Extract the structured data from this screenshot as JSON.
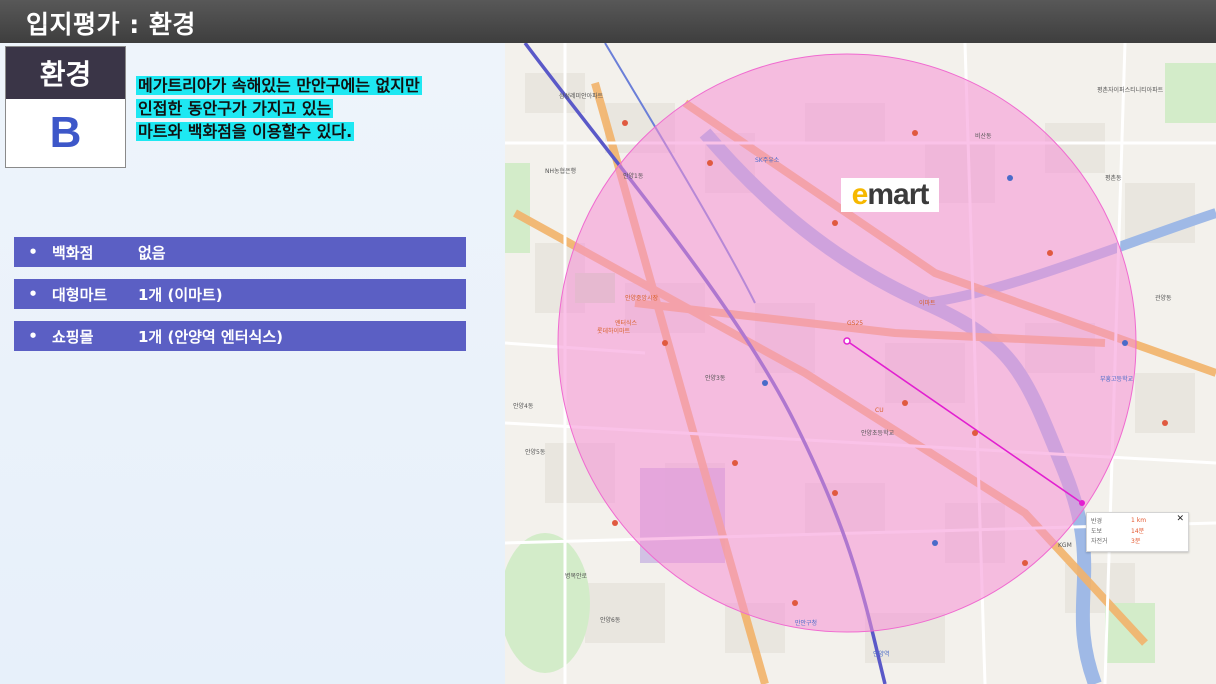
{
  "header": {
    "title": "입지평가 : 환경"
  },
  "grade": {
    "label": "환경",
    "value": "B"
  },
  "note": {
    "lines": [
      "메가트리아가 속해있는 만안구에는 없지만",
      "인접한 동안구가 가지고 있는",
      "마트와 백화점을 이용할수 있다."
    ]
  },
  "facilities": [
    {
      "bullet": "•",
      "name": "백화점",
      "value": "없음"
    },
    {
      "bullet": "•",
      "name": "대형마트",
      "value": "1개 (이마트)"
    },
    {
      "bullet": "•",
      "name": "쇼핑몰",
      "value": "1개 (안양역 엔터식스)"
    }
  ],
  "map": {
    "logo": {
      "prefix": "e",
      "rest": "mart"
    },
    "radius_circle_color": "#f58fd6",
    "measure_line_color": "#e21fd0",
    "popup": {
      "rows": [
        {
          "k": "반경",
          "v": "1 km"
        },
        {
          "k": "도보",
          "v": "14분"
        },
        {
          "k": "자전거",
          "v": "3분"
        }
      ],
      "close": "✕"
    },
    "places": [
      "삼성레미안아파트",
      "안양1동",
      "안양3동",
      "만안구청",
      "안양역",
      "SK주유소",
      "NH농협은행",
      "안양초등학교",
      "평촌자이퍼스티니티아파트",
      "이마트",
      "GS25",
      "CU",
      "안양4동",
      "안양5동",
      "안양6동",
      "병목안로",
      "평촌동",
      "비산동",
      "관양동",
      "KGM",
      "부흥고등학교",
      "엔터식스",
      "안양중앙시장",
      "롯데하이마트"
    ]
  }
}
